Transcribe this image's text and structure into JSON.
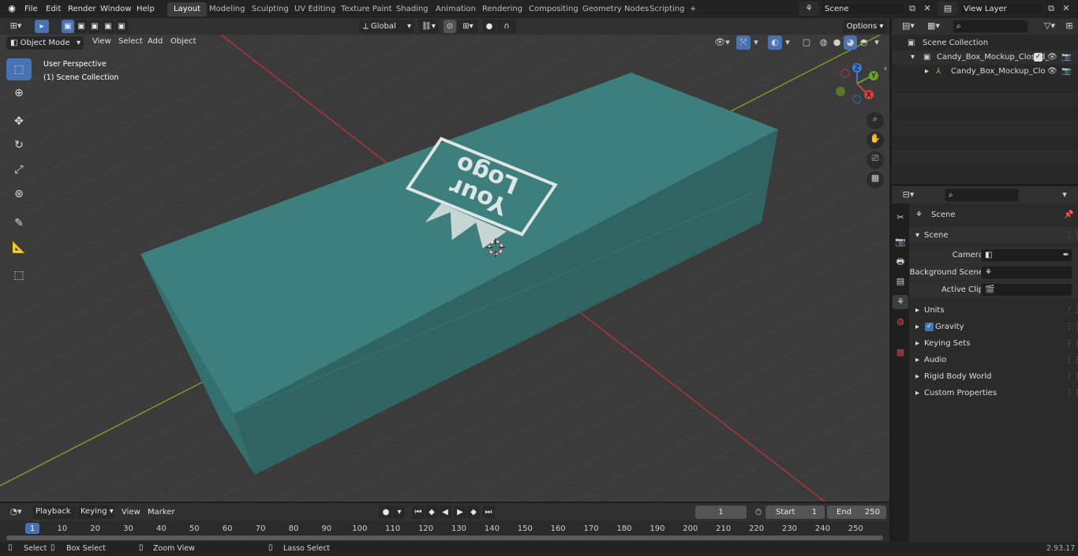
{
  "topbar": {
    "menus": [
      "File",
      "Edit",
      "Render",
      "Window",
      "Help"
    ],
    "workspaces": [
      "Layout",
      "Modeling",
      "Sculpting",
      "UV Editing",
      "Texture Paint",
      "Shading",
      "Animation",
      "Rendering",
      "Compositing",
      "Geometry Nodes",
      "Scripting"
    ],
    "active_workspace": "Layout",
    "add_workspace": "+",
    "scene_name": "Scene",
    "view_layer": "View Layer"
  },
  "viewport": {
    "mode": "Object Mode",
    "menus": [
      "View",
      "Select",
      "Add",
      "Object"
    ],
    "transform_orientation": "Global",
    "options_label": "Options",
    "overlay_line1": "User Perspective",
    "overlay_line2": "(1) Scene Collection",
    "logo_text_line1": "Your",
    "logo_text_line2": "Logo",
    "box_color": "#3d7f7d",
    "gizmo": {
      "z": "Z",
      "y": "Y",
      "x": "X"
    }
  },
  "outliner": {
    "search_placeholder": "",
    "root": "Scene Collection",
    "items": [
      {
        "label": "Candy_Box_Mockup_Closed_"
      },
      {
        "label": "Candy_Box_Mockup_Clo"
      }
    ]
  },
  "properties": {
    "header": "Scene",
    "panel": "Scene",
    "camera_label": "Camera",
    "background_scene_label": "Background Scene",
    "active_clip_label": "Active Clip",
    "sections": [
      "Units",
      "Gravity",
      "Keying Sets",
      "Audio",
      "Rigid Body World",
      "Custom Properties"
    ]
  },
  "timeline": {
    "menus": [
      "Playback",
      "Keying",
      "View",
      "Marker"
    ],
    "current_frame": "1",
    "start_label": "Start",
    "start_value": "1",
    "end_label": "End",
    "end_value": "250",
    "ticks": [
      "1",
      "10",
      "20",
      "30",
      "40",
      "50",
      "60",
      "70",
      "80",
      "90",
      "100",
      "110",
      "120",
      "130",
      "140",
      "150",
      "160",
      "170",
      "180",
      "190",
      "200",
      "210",
      "220",
      "230",
      "240",
      "250"
    ]
  },
  "statusbar": {
    "select": "Select",
    "box_select": "Box Select",
    "zoom_view": "Zoom View",
    "lasso_select": "Lasso Select",
    "version": "2.93.17"
  }
}
